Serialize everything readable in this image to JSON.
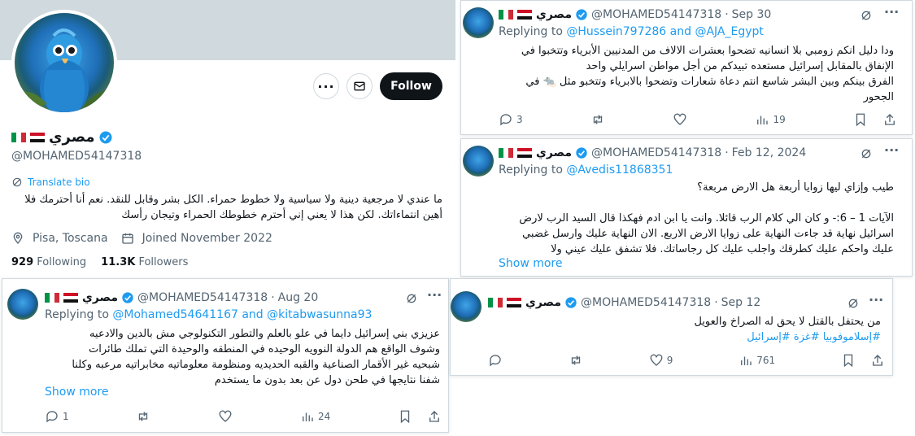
{
  "profile": {
    "display_name": "مصري",
    "handle": "@MOHAMED54147318",
    "translate_bio": "Translate bio",
    "bio": "ما عندي لا مرجعية دينية ولا سياسية ولا خطوط حمراء. الكل بشر وقابل للنقد. نعم أنا أحترمك فلا أهين انتماءاتك. لكن هذا لا يعني إني أحترم خطوطك الحمراء وتيجان رأسك",
    "location": "Pisa, Toscana",
    "joined": "Joined November 2022",
    "following_count": "929",
    "following_label": "Following",
    "followers_count": "11.3K",
    "followers_label": "Followers",
    "follow_button": "Follow",
    "icons": [
      "more-icon",
      "message-icon",
      "verified-icon",
      "translate-icon",
      "location-icon",
      "calendar-icon"
    ]
  },
  "colors": {
    "accent": "#1d9bf0",
    "verified": "#1d9bf0",
    "follow_bg": "#0f1419",
    "muted": "#536471",
    "banner": "#cfd9de"
  },
  "tweets": [
    {
      "name": "مصري",
      "handle": "@MOHAMED54147318",
      "date": "Sep 30",
      "replying_label": "Replying to",
      "replying_to": "@Hussein797286 and @AJA_Egypt",
      "text_line1": "ودا دليل انكم زومبي بلا انسانيه تضحوا بعشرات الالاف من المدنيين الأبرياء وتتخبوا في",
      "text_line2": "الإنفاق بالمقابل إسرائيل مستعده تبيدكم من أجل مواطن اسرايلي واحد",
      "text_line3": "الفرق بينكم وبين البشر شاسع انتم دعاة شعارات وتضحوا بالابرياء وتتخبو مثل 🐀 في",
      "text_line4": "الجحور",
      "replies": "3",
      "reposts": "",
      "likes": "",
      "views": "19"
    },
    {
      "name": "مصري",
      "handle": "@MOHAMED54147318",
      "date": "Feb 12, 2024",
      "replying_label": "Replying to",
      "replying_to": "@Avedis11868351",
      "text_line1": "طيب وإزاي ليها زوايا أربعة هل الارض مربعة؟",
      "text_line2": "الآيات 1 – 6:- و كان الي كلام الرب قائلا. وانت يا ابن ادم فهكذا قال السيد الرب لارض",
      "text_line3": "اسرائيل نهاية قد جاءت النهاية على زوايا الارض الاربع. الان النهاية عليك وارسل غضبي",
      "text_line4": "عليك واحكم عليك كطرقك واجلب عليك كل رجاساتك. فلا تشفق عليك عيني ولا",
      "show_more": "Show more"
    },
    {
      "name": "مصري",
      "handle": "@MOHAMED54147318",
      "date": "Aug 20",
      "replying_label": "Replying to",
      "replying_to": "@Mohamed54641167 and @kitabwasunna93",
      "text_line1": "عزيزي بني إسرائيل دايما في علو بالعلم والتطور التكنولوجي مش بالدين والادعيه",
      "text_line2": "وشوف الواقع هم الدولة النوويه الوحيده في المنطقه والوحيدة التي تملك طائرات",
      "text_line3": "شبحيه غير الأقمار الصناعية والقبه الحديديه ومنظومة معلوماتيه مخابراتيه مرعبه وكلنا",
      "text_line4": "شفنا نتايجها في طحن دول عن بعد بدون ما يستخدم",
      "show_more": "Show more",
      "replies": "1",
      "views": "24"
    },
    {
      "name": "مصري",
      "handle": "@MOHAMED54147318",
      "date": "Sep 12",
      "text_line1": "من يحتفل بالقتل  لا يحق له الصراخ والعويل",
      "hashtags": "#إسلاموفوبيا #غزة #إسرائيل",
      "likes": "9",
      "views": "761"
    }
  ]
}
